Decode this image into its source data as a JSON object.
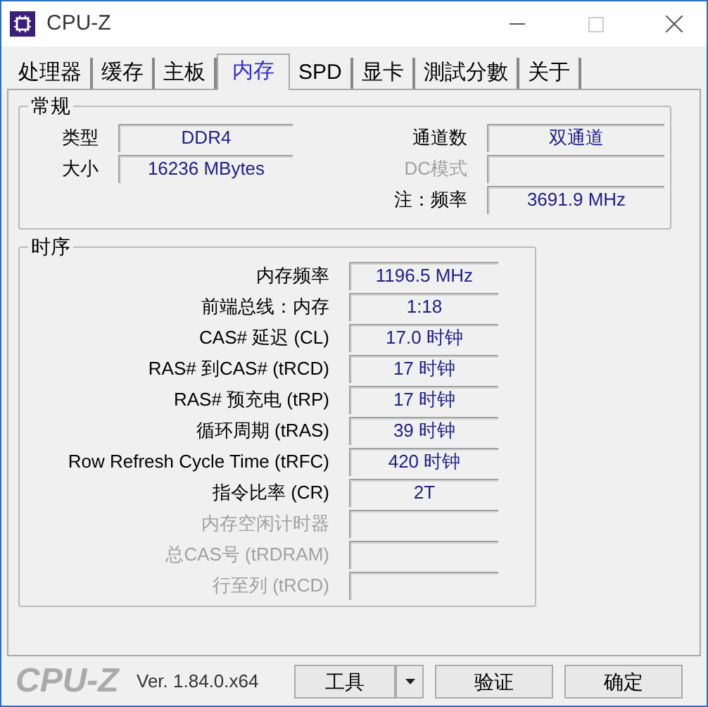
{
  "window": {
    "title": "CPU-Z"
  },
  "tabs": [
    {
      "label": "处理器",
      "selected": false
    },
    {
      "label": "缓存",
      "selected": false
    },
    {
      "label": "主板",
      "selected": false
    },
    {
      "label": "内存",
      "selected": true
    },
    {
      "label": "SPD",
      "selected": false
    },
    {
      "label": "显卡",
      "selected": false
    },
    {
      "label": "測試分數",
      "selected": false
    },
    {
      "label": "关于",
      "selected": false
    }
  ],
  "general": {
    "title": "常规",
    "left": [
      {
        "label": "类型",
        "value": "DDR4",
        "disabled": false
      },
      {
        "label": "大小",
        "value": "16236 MBytes",
        "disabled": false
      }
    ],
    "right": [
      {
        "label": "通道数",
        "value": "双通道",
        "disabled": false
      },
      {
        "label": "DC模式",
        "disabled": true
      },
      {
        "label": "注：频率",
        "value": "3691.9 MHz",
        "disabled": false
      }
    ]
  },
  "timings": {
    "title": "时序",
    "rows": [
      {
        "label": "内存频率",
        "value": "1196.5 MHz",
        "disabled": false
      },
      {
        "label": "前端总线：内存",
        "value": "1:18",
        "disabled": false
      },
      {
        "label": "CAS# 延迟 (CL)",
        "value": "17.0 时钟",
        "disabled": false
      },
      {
        "label": "RAS# 到CAS# (tRCD)",
        "value": "17 时钟",
        "disabled": false
      },
      {
        "label": "RAS# 预充电 (tRP)",
        "value": "17 时钟",
        "disabled": false
      },
      {
        "label": "循环周期 (tRAS)",
        "value": "39 时钟",
        "disabled": false
      },
      {
        "label": "Row Refresh Cycle Time (tRFC)",
        "value": "420 时钟",
        "disabled": false
      },
      {
        "label": "指令比率 (CR)",
        "value": "2T",
        "disabled": false
      },
      {
        "label": "内存空闲计时器",
        "disabled": true
      },
      {
        "label": "总CAS号 (tRDRAM)",
        "disabled": true
      },
      {
        "label": "行至列 (tRCD)",
        "disabled": true
      }
    ]
  },
  "footer": {
    "logo": "CPU-Z",
    "version": "Ver. 1.84.0.x64",
    "buttons": [
      {
        "label": "工具",
        "kind": "dropdown"
      },
      {
        "label": "验证",
        "kind": "plain"
      },
      {
        "label": "确定",
        "kind": "plain"
      }
    ]
  }
}
